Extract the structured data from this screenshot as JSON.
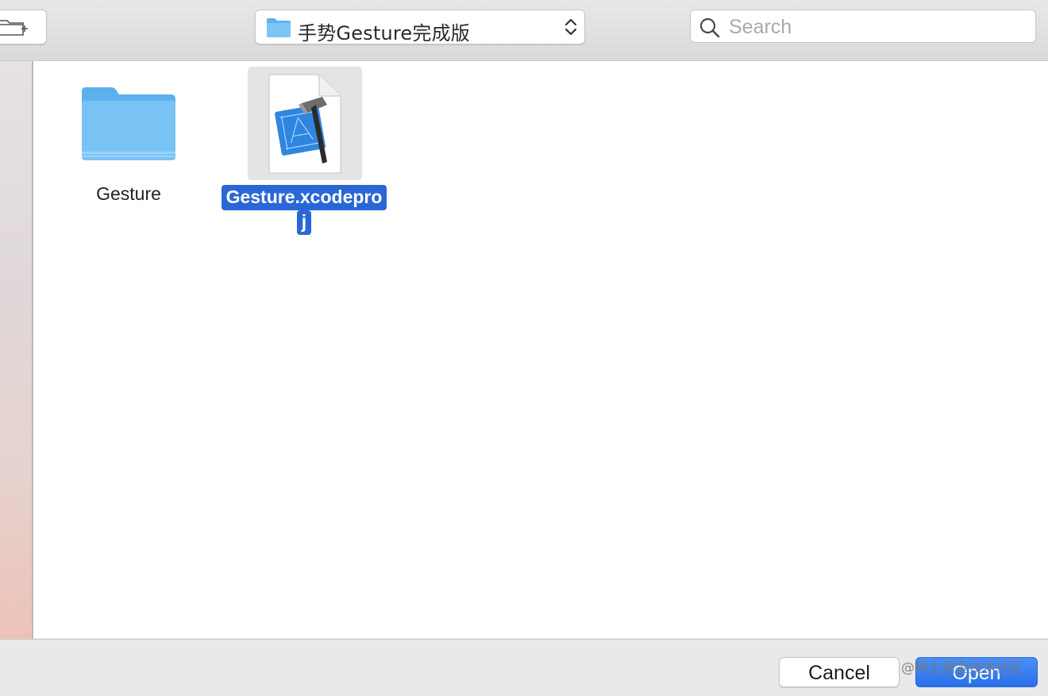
{
  "toolbar": {
    "new_folder_icon": "new-folder-icon",
    "path": {
      "icon": "folder-icon",
      "label": "手势Gesture完成版",
      "chevron_icon": "updown-chevron-icon"
    },
    "search": {
      "icon": "search-icon",
      "placeholder": "Search",
      "value": ""
    }
  },
  "files": [
    {
      "name": "Gesture",
      "kind": "folder",
      "icon": "folder-icon",
      "selected": false
    },
    {
      "name_line1": "Gesture.xcodepro",
      "name_line2": "j",
      "kind": "xcode-project",
      "icon": "xcodeproj-icon",
      "selected": true
    }
  ],
  "buttons": {
    "cancel": "Cancel",
    "open": "Open"
  },
  "watermark": "@稀土掘金技术社区",
  "colors": {
    "selection": "#2a67d6",
    "folder": "#6cbcf2",
    "primary_button": "#2f74ec"
  }
}
